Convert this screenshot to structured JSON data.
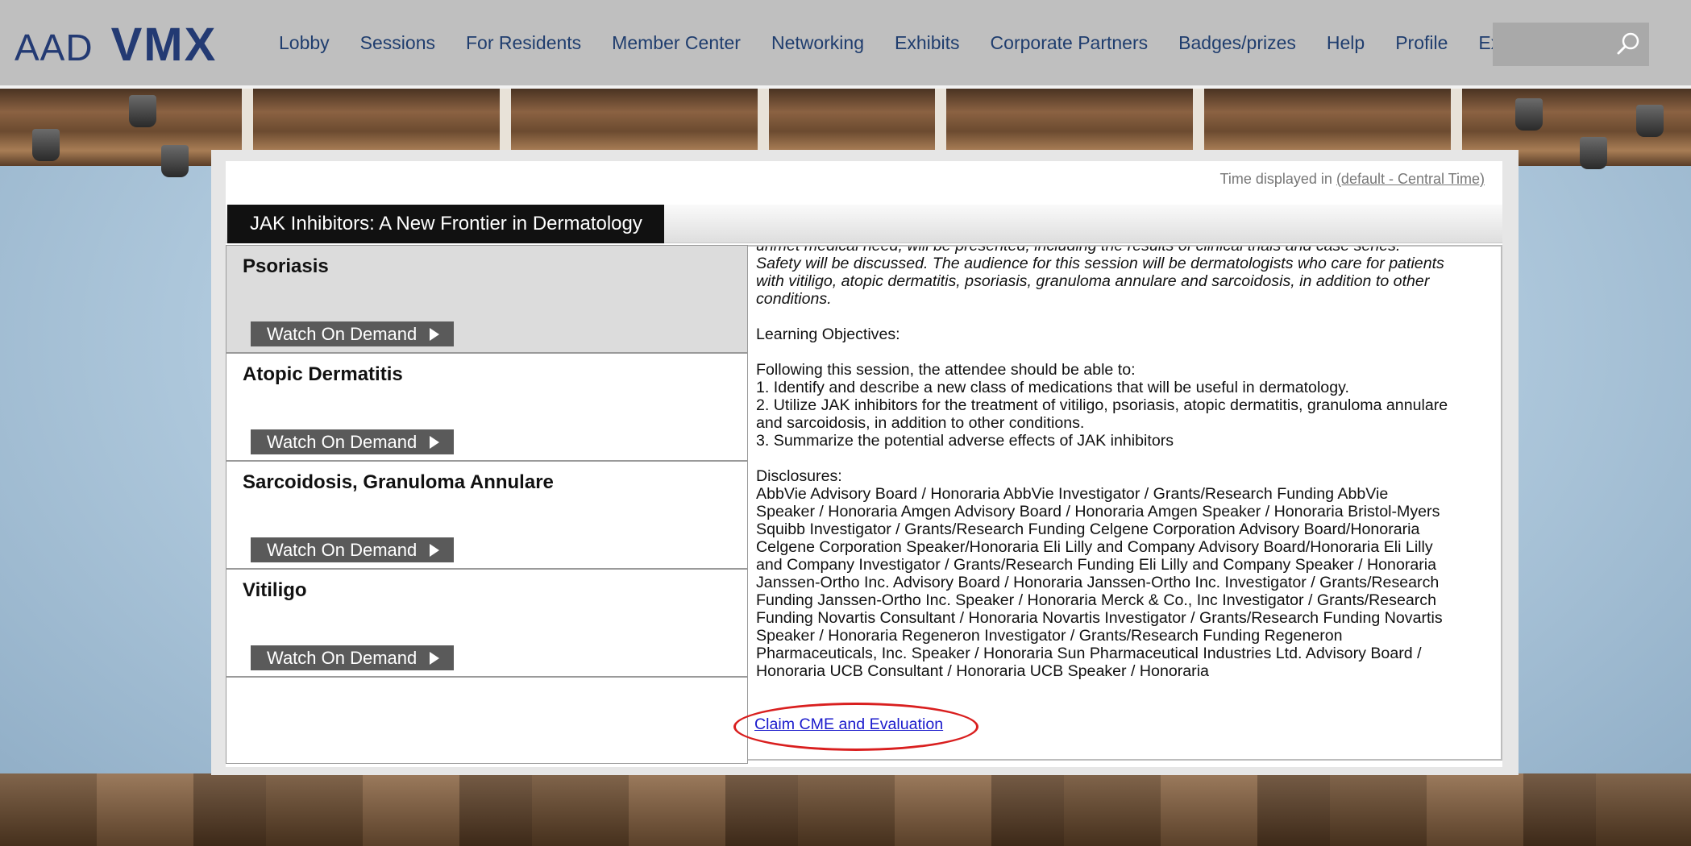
{
  "brand": {
    "aad": "AAD",
    "vmx": "VMX"
  },
  "nav": [
    "Lobby",
    "Sessions",
    "For Residents",
    "Member Center",
    "Networking",
    "Exhibits",
    "Corporate Partners",
    "Badges/prizes",
    "Help",
    "Profile",
    "Exit"
  ],
  "search": {
    "placeholder": ""
  },
  "time_note": {
    "prefix": "Time displayed in ",
    "link": "(default - Central Time)"
  },
  "session": {
    "title": "JAK Inhibitors: A New Frontier in Dermatology",
    "watch_label": "Watch On Demand",
    "items": [
      {
        "name": "Psoriasis"
      },
      {
        "name": "Atopic Dermatitis"
      },
      {
        "name": "Sarcoidosis, Granuloma Annulare"
      },
      {
        "name": "Vitiligo"
      }
    ]
  },
  "description": {
    "intro": "unmet medical need, will be presented, including the results of clinical trials and case series. Safety will be discussed. The audience for this session will be dermatologists who care for patients with vitiligo, atopic dermatitis, psoriasis, granuloma annulare and sarcoidosis, in addition to other conditions.",
    "objectives_heading": "Learning Objectives:",
    "objectives_intro": "Following this session, the attendee should be able to:",
    "objectives": [
      "1. Identify and describe a new class of medications that will be useful in dermatology.",
      "2. Utilize JAK inhibitors for the treatment of vitiligo, psoriasis, atopic dermatitis, granuloma annulare and sarcoidosis, in addition to other conditions.",
      "3. Summarize the potential adverse effects of JAK inhibitors"
    ],
    "disclosures_heading": "Disclosures:",
    "disclosures": "AbbVie Advisory Board / Honoraria AbbVie Investigator / Grants/Research Funding AbbVie Speaker / Honoraria Amgen Advisory Board / Honoraria Amgen Speaker / Honoraria Bristol-Myers Squibb Investigator / Grants/Research Funding Celgene Corporation Advisory Board/Honoraria Celgene Corporation Speaker/Honoraria Eli Lilly and Company Advisory Board/Honoraria Eli Lilly and Company Investigator / Grants/Research Funding Eli Lilly and Company Speaker / Honoraria Janssen-Ortho Inc. Advisory Board / Honoraria Janssen-Ortho Inc. Investigator / Grants/Research Funding Janssen-Ortho Inc. Speaker / Honoraria Merck & Co., Inc Investigator / Grants/Research Funding Novartis Consultant / Honoraria Novartis Investigator / Grants/Research Funding Novartis Speaker / Honoraria Regeneron Investigator / Grants/Research Funding Regeneron Pharmaceuticals, Inc. Speaker / Honoraria Sun Pharmaceutical Industries Ltd. Advisory Board / Honoraria UCB Consultant / Honoraria UCB Speaker / Honoraria",
    "claim_link": "Claim CME and Evaluation"
  },
  "colors": {
    "nav_text": "#1f3d6e",
    "brand": "#233a73",
    "link": "#1a1acc",
    "highlight_ring": "#d91f1f"
  }
}
